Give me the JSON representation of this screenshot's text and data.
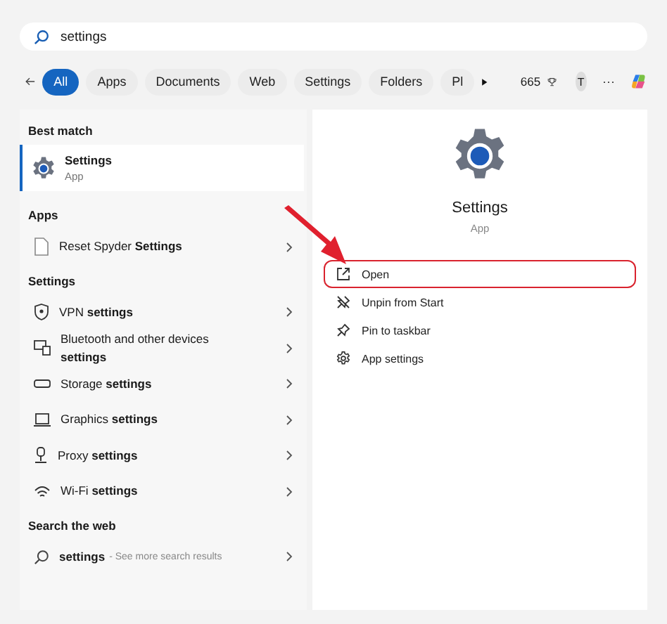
{
  "search": {
    "value": "settings"
  },
  "filters": [
    {
      "label": "All",
      "selected": true
    },
    {
      "label": "Apps",
      "selected": false
    },
    {
      "label": "Documents",
      "selected": false
    },
    {
      "label": "Web",
      "selected": false
    },
    {
      "label": "Settings",
      "selected": false
    },
    {
      "label": "Folders",
      "selected": false
    },
    {
      "label": "Pl",
      "selected": false
    }
  ],
  "points": "665",
  "avatar": "T",
  "more": "···",
  "sections": [
    {
      "heading": "Best match",
      "items": [
        {
          "kind": "best",
          "title": "Settings",
          "subtitle": "App",
          "selected": true
        }
      ]
    },
    {
      "heading": "Apps",
      "items": [
        {
          "kind": "app",
          "title": "Reset Spyder **Settings**"
        }
      ]
    },
    {
      "heading": "Settings",
      "items": [
        {
          "kind": "setting",
          "title": "VPN **settings**"
        },
        {
          "kind": "setting",
          "title": "Bluetooth and other devices **settings**"
        },
        {
          "kind": "setting",
          "title": "Storage **settings**"
        },
        {
          "kind": "setting",
          "title": "Graphics **settings**"
        },
        {
          "kind": "setting",
          "title": "Proxy **settings**"
        },
        {
          "kind": "setting",
          "title": "Wi-Fi **settings**"
        }
      ]
    },
    {
      "heading": "Search the web",
      "items": [
        {
          "kind": "web",
          "title": "settings",
          "hint": "- See more search results"
        }
      ]
    }
  ],
  "detail": {
    "title": "Settings",
    "subtitle": "App",
    "actions": [
      {
        "label": "Open",
        "highlighted": true
      },
      {
        "label": "Unpin from Start",
        "highlighted": false
      },
      {
        "label": "Pin to taskbar",
        "highlighted": false
      },
      {
        "label": "App settings",
        "highlighted": false
      }
    ]
  }
}
